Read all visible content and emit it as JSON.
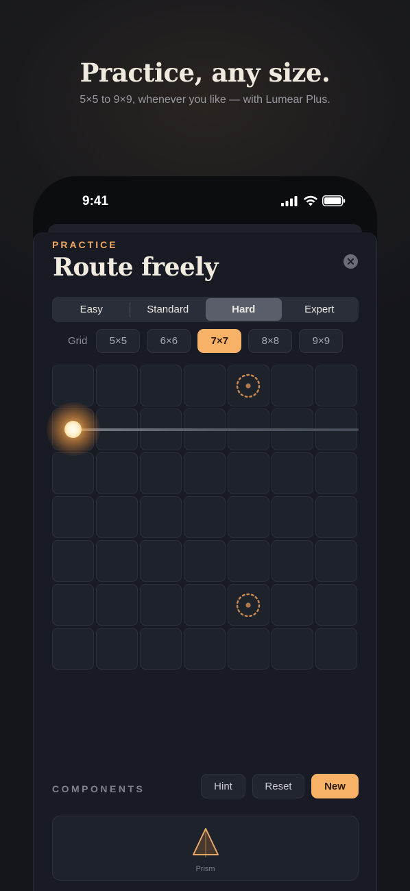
{
  "hero": {
    "title": "Practice, any size.",
    "subtitle": "5×5 to 9×9, whenever you like — with Lumear Plus."
  },
  "status_bar": {
    "time": "9:41",
    "icons": [
      "signal-icon",
      "wifi-icon",
      "battery-icon"
    ]
  },
  "header": {
    "eyebrow": "PRACTICE",
    "title": "Route freely",
    "close_icon": "close-icon"
  },
  "difficulty": {
    "options": [
      "Easy",
      "Standard",
      "Hard",
      "Expert"
    ],
    "selected": "Hard"
  },
  "grid_size": {
    "label": "Grid",
    "options": [
      "5×5",
      "6×6",
      "7×7",
      "8×8",
      "9×9"
    ],
    "selected": "7×7"
  },
  "board": {
    "rows": 7,
    "cols": 7,
    "source": {
      "row": 1,
      "col": 0
    },
    "targets": [
      {
        "row": 0,
        "col": 4
      },
      {
        "row": 5,
        "col": 4
      }
    ]
  },
  "components": {
    "label": "COMPONENTS",
    "actions": [
      "Hint",
      "Reset",
      "New"
    ],
    "items": [
      {
        "name": "Prism",
        "icon": "prism-icon"
      }
    ]
  },
  "colors": {
    "accent": "#f7b267",
    "eyebrow": "#f0a860",
    "sheet_bg": "#181b23",
    "cell_bg": "#1e222b"
  }
}
